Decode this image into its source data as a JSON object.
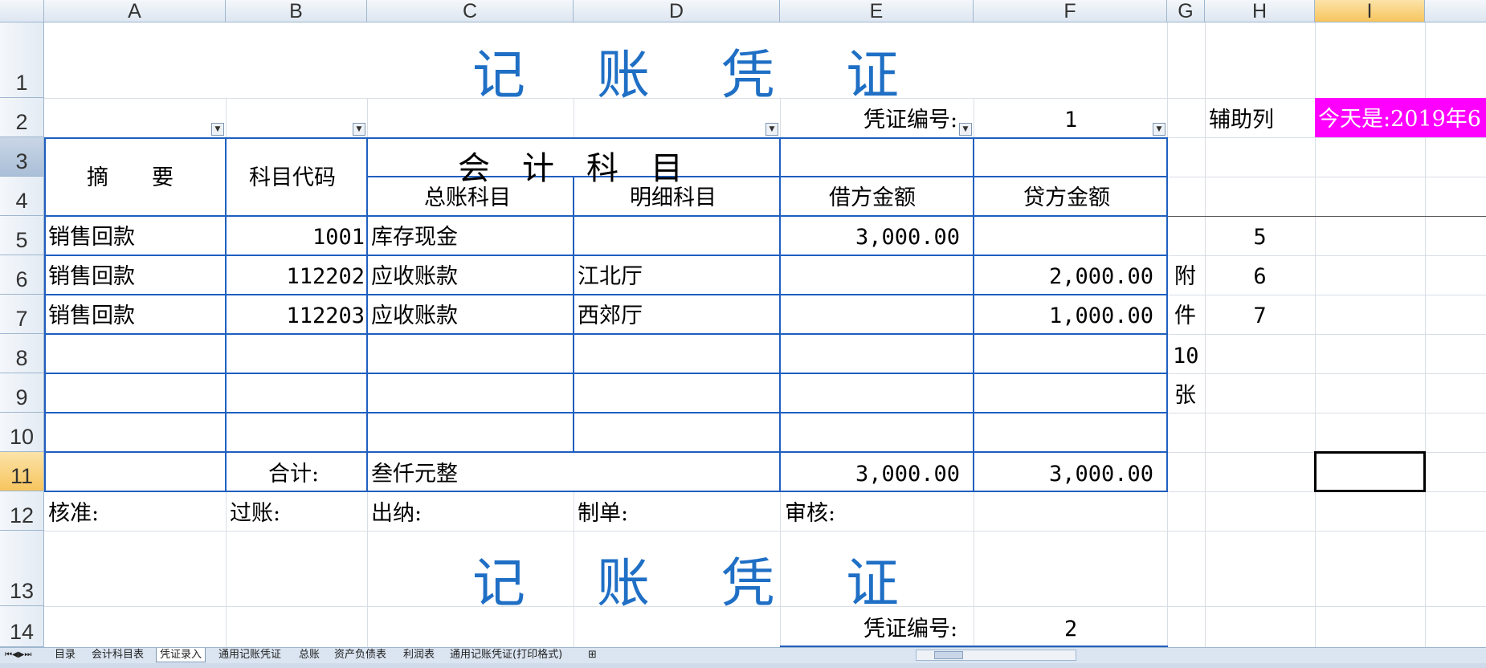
{
  "columns": [
    "A",
    "B",
    "C",
    "D",
    "E",
    "F",
    "G",
    "H",
    "I"
  ],
  "rows": [
    "1",
    "2",
    "3",
    "4",
    "5",
    "6",
    "7",
    "8",
    "9",
    "10",
    "11",
    "12",
    "13",
    "14"
  ],
  "voucher": {
    "title": "记 账 凭 证",
    "number_label": "凭证编号:",
    "number": "1",
    "aux_label": "辅助列",
    "today_text": "今天是:2019年6",
    "header": {
      "summary": "摘　　要",
      "code": "科目代码",
      "account": "会　计　科　目",
      "general": "总账科目",
      "detail": "明细科目",
      "debit": "借方金额",
      "credit": "贷方金额"
    },
    "entries": [
      {
        "summary": "销售回款",
        "code": "1001",
        "general": "库存现金",
        "detail": "",
        "debit": "3,000.00",
        "credit": "",
        "aux": "5"
      },
      {
        "summary": "销售回款",
        "code": "112202",
        "general": "应收账款",
        "detail": "江北厅",
        "debit": "",
        "credit": "2,000.00",
        "aux": "6"
      },
      {
        "summary": "销售回款",
        "code": "112203",
        "general": "应收账款",
        "detail": "西郊厅",
        "debit": "",
        "credit": "1,000.00",
        "aux": "7"
      }
    ],
    "attachment": [
      "附",
      "件",
      "10",
      "张"
    ],
    "total_label": "合计:",
    "total_words": "叁仟元整",
    "total_debit": "3,000.00",
    "total_credit": "3,000.00",
    "signatures": [
      "核准:",
      "过账:",
      "出纳:",
      "制单:",
      "审核:"
    ]
  },
  "voucher2": {
    "title": "记 账 凭 证",
    "number_label": "凭证编号:",
    "number": "2"
  },
  "sheet_tabs": [
    "目录",
    "会计科目表",
    "凭证录入",
    "通用记账凭证",
    "总账",
    "资产负债表",
    "利润表",
    "通用记账凭证(打印格式)"
  ],
  "active_tab": "凭证录入",
  "colors": {
    "title": "#1f6fc5",
    "border": "#1f5fbf",
    "today_bg": "#ff00ff",
    "selected_header": "#f7c55e"
  }
}
